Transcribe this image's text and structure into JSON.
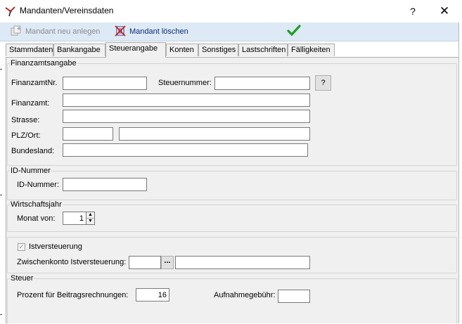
{
  "window": {
    "title": "Mandanten/Vereinsdaten",
    "help_label": "?",
    "close_label": "✕"
  },
  "toolbar": {
    "new_label": "Mandant neu anlegen",
    "delete_label": "Mandant löschen",
    "ok_icon": "checkmark-icon"
  },
  "tabs": [
    {
      "label": "Stammdaten"
    },
    {
      "label": "Bankangabe"
    },
    {
      "label": "Steuerangabe"
    },
    {
      "label": "Konten"
    },
    {
      "label": "Sonstiges"
    },
    {
      "label": "Lastschriften"
    },
    {
      "label": "Fälligkeiten"
    }
  ],
  "active_tab": "Steuerangabe",
  "finanzamt": {
    "legend": "Finanzamtsangabe",
    "nr_label": "FinanzamtNr.",
    "nr_value": "",
    "steuernummer_label": "Steuernummer:",
    "steuernummer_value": "",
    "lookup_label": "?",
    "name_label": "Finanzamt:",
    "name_value": "",
    "strasse_label": "Strasse:",
    "strasse_value": "",
    "plz_ort_label": "PLZ/Ort:",
    "plz_value": "",
    "ort_value": "",
    "bundesland_label": "Bundesland:",
    "bundesland_value": ""
  },
  "id_nummer": {
    "legend": "ID-Nummer",
    "label": "ID-Nummer:",
    "value": ""
  },
  "wirtschaftsjahr": {
    "legend": "Wirtschaftsjahr",
    "monat_label": "Monat von:",
    "monat_value": "1"
  },
  "istversteuerung": {
    "checkbox_label": "Istversteuerung",
    "checked": true,
    "zwischenkonto_label": "Zwischenkonto Istversteuerung:",
    "konto_value": "",
    "browse_label": "...",
    "konto_name_value": ""
  },
  "steuer": {
    "legend": "Steuer",
    "prozent_label": "Prozent für Beitragsrechnungen:",
    "prozent_value": "16",
    "aufnahme_label": "Aufnahmegebühr:",
    "aufnahme_value": ""
  },
  "colors": {
    "toolbar_bg": "#dde9f5",
    "panel_bg": "#f0f0f0",
    "ok_green": "#1e9e1e",
    "delete_blue": "#0c2a7a"
  }
}
